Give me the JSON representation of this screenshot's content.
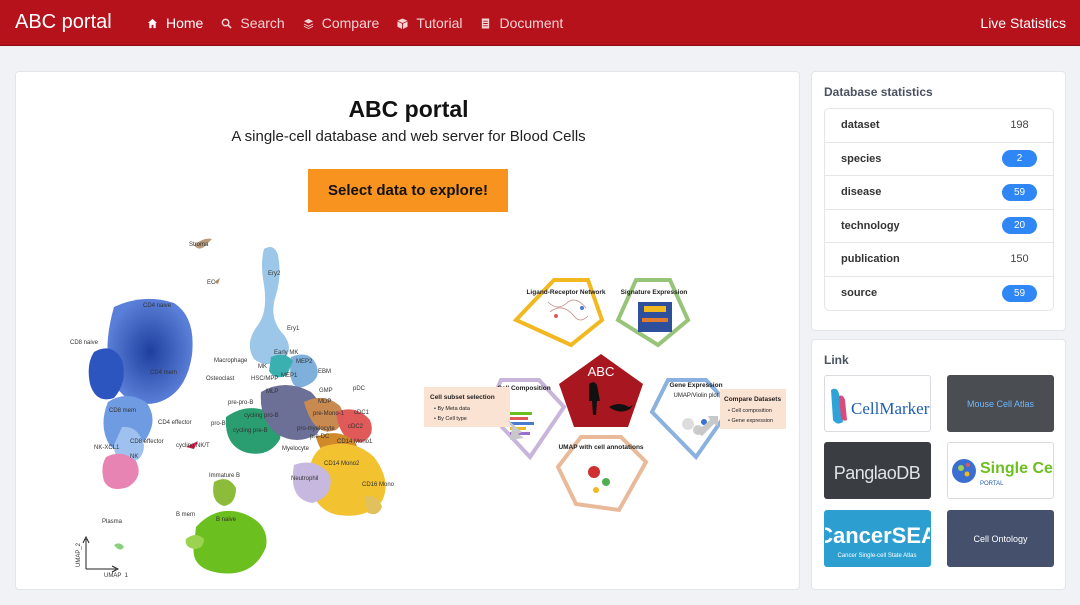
{
  "nav": {
    "brand": "ABC portal",
    "items": [
      {
        "label": "Home",
        "icon": "home-icon"
      },
      {
        "label": "Search",
        "icon": "search-icon"
      },
      {
        "label": "Compare",
        "icon": "layers-icon"
      },
      {
        "label": "Tutorial",
        "icon": "cube-icon"
      },
      {
        "label": "Document",
        "icon": "document-icon"
      }
    ],
    "right_label": "Live Statistics",
    "colors": {
      "bar": "#b5121b",
      "accent": "#f7931e",
      "pill": "#2f86f5"
    }
  },
  "hero": {
    "title": "ABC portal",
    "subtitle": "A single-cell database and web server for Blood Cells",
    "cta_label": "Select data to explore!"
  },
  "umap": {
    "labels": [
      "Stroma",
      "EC",
      "Ery2",
      "CD4 naive",
      "CD8 naive",
      "Ery1",
      "Early MK",
      "MK",
      "Macrophage",
      "MEP2",
      "CD4 mem",
      "EBM",
      "MEP1",
      "Osteoclast",
      "HSC/MPP",
      "pDC",
      "MLP",
      "GMP",
      "MDP",
      "pre-pro-B",
      "cDC1",
      "CD8 mem",
      "cycling pro-B",
      "pre-Mono-1",
      "CD4 effector",
      "pro-B",
      "cDC2",
      "cycling pre-B",
      "pro-myelocyte",
      "CD8 effector",
      "pre-DC",
      "NK-XCL1",
      "cycling NK/T",
      "CD14 Mono1",
      "NK",
      "Myelocyte",
      "CD14 Mono2",
      "Neutrophil",
      "CD16 Mono",
      "Immature B",
      "B mem",
      "B naive",
      "Plasma"
    ],
    "axis_x": "UMAP_1",
    "axis_y": "UMAP_2"
  },
  "workflow": {
    "center": "ABC",
    "modules": [
      {
        "title": "Ligand-Receptor Network"
      },
      {
        "title": "Signature Expression"
      },
      {
        "title": "Gene Expression",
        "sub": "UMAP/Violin plot"
      },
      {
        "title": "UMAP with cell annotations"
      },
      {
        "title": "Cell Composition"
      }
    ],
    "subset_box": {
      "title": "Cell subset selection",
      "items": [
        "By Meta data",
        "By Cell type"
      ]
    },
    "compare_box": {
      "title": "Compare Datasets",
      "items": [
        "Cell composition",
        "Gene expression"
      ]
    }
  },
  "stats": {
    "title": "Database statistics",
    "rows": [
      {
        "label": "dataset",
        "value": "198",
        "pill": false
      },
      {
        "label": "species",
        "value": "2",
        "pill": true
      },
      {
        "label": "disease",
        "value": "59",
        "pill": true
      },
      {
        "label": "technology",
        "value": "20",
        "pill": true
      },
      {
        "label": "publication",
        "value": "150",
        "pill": false
      },
      {
        "label": "source",
        "value": "59",
        "pill": true
      }
    ]
  },
  "links": {
    "title": "Link",
    "tiles": [
      {
        "name": "CellMarker"
      },
      {
        "name": "Mouse Cell Atlas"
      },
      {
        "name": "PanglaoDB"
      },
      {
        "name": "Single Cell",
        "sub": "PORTAL"
      },
      {
        "name": "CancerSEA",
        "sub": "Cancer  Single-cell State Atlas"
      },
      {
        "name": "Cell Ontology"
      }
    ]
  }
}
